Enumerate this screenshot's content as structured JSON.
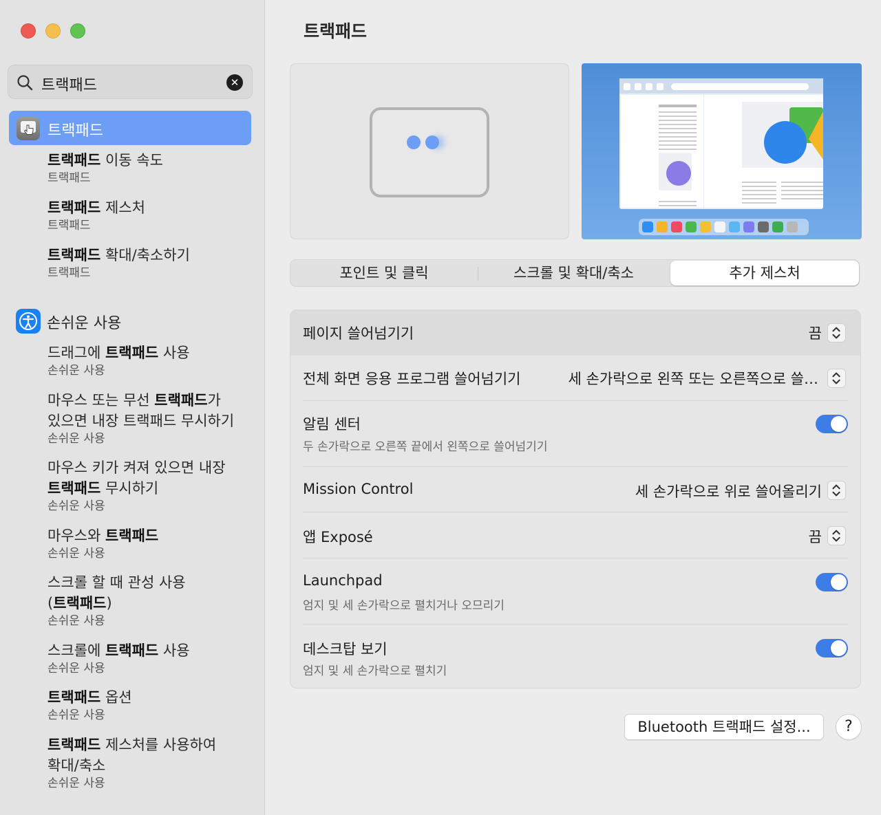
{
  "sidebar": {
    "search": {
      "value": "트랙패드",
      "placeholder": ""
    },
    "selected": {
      "label": "트랙패드"
    },
    "results_top": [
      {
        "title": "트랙패드 이동 속도",
        "bold": "트랙패드",
        "rest": " 이동 속도",
        "sub": "트랙패드"
      },
      {
        "title": "트랙패드 제스처",
        "bold": "트랙패드",
        "rest": " 제스처",
        "sub": "트랙패드"
      },
      {
        "title": "트랙패드 확대/축소하기",
        "bold": "트랙패드",
        "rest": " 확대/축소하기",
        "sub": "트랙패드"
      }
    ],
    "section": {
      "label": "손쉬운 사용"
    },
    "results_accessibility": [
      {
        "lines": [
          "드래그에 [트랙패드] 사용"
        ],
        "sub": "손쉬운 사용"
      },
      {
        "lines": [
          "마우스 또는 무선 [트랙패드]가",
          "있으면 내장 트랙패드 무시하기"
        ],
        "sub": "손쉬운 사용"
      },
      {
        "lines": [
          "마우스 키가 켜져 있으면 내장",
          "[트랙패드] 무시하기"
        ],
        "sub": "손쉬운 사용"
      },
      {
        "lines": [
          "마우스와 [트랙패드]"
        ],
        "sub": "손쉬운 사용"
      },
      {
        "lines": [
          "스크롤 할 때 관성 사용",
          "([트랙패드])"
        ],
        "sub": "손쉬운 사용"
      },
      {
        "lines": [
          "스크롤에 [트랙패드] 사용"
        ],
        "sub": "손쉬운 사용"
      },
      {
        "lines": [
          "[트랙패드] 옵션"
        ],
        "sub": "손쉬운 사용"
      },
      {
        "lines": [
          "[트랙패드] 제스처를 사용하여",
          "확대/축소"
        ],
        "sub": "손쉬운 사용"
      }
    ]
  },
  "main": {
    "title": "트랙패드",
    "tabs": [
      {
        "label": "포인트 및 클릭"
      },
      {
        "label": "스크롤 및 확대/축소"
      },
      {
        "label": "추가 제스처"
      }
    ],
    "rows": [
      {
        "label": "페이지 쓸어넘기기",
        "value": "끔",
        "type": "select"
      },
      {
        "label": "전체 화면 응용 프로그램 쓸어넘기기",
        "value": "세 손가락으로 왼쪽 또는 오른쪽으로 쓸…",
        "type": "select"
      },
      {
        "label": "알림 센터",
        "sub": "두 손가락으로 오른쪽 끝에서 왼쪽으로 쓸어넘기기",
        "type": "toggle",
        "on": true
      },
      {
        "label": "Mission Control",
        "value": "세 손가락으로 위로 쓸어올리기",
        "type": "select"
      },
      {
        "label": "앱 Exposé",
        "value": "끔",
        "type": "select"
      },
      {
        "label": "Launchpad",
        "sub": "엄지 및 세 손가락으로 펼치거나 오므리기",
        "type": "toggle",
        "on": true
      },
      {
        "label": "데스크탑 보기",
        "sub": "엄지 및 세 손가락으로 펼치기",
        "type": "toggle",
        "on": true
      }
    ],
    "bluetooth_button": "Bluetooth 트랙패드 설정...",
    "help_button": "?"
  },
  "colors": {
    "accent": "#6b9ef4",
    "toggle_on": "#3f7de6",
    "accessibility_icon": "#1a80f5"
  },
  "icons": {
    "search": "search-icon",
    "clear": "clear-search-icon",
    "trackpad": "trackpad-icon",
    "accessibility": "accessibility-icon",
    "stepper": "chevron-up-down-icon"
  }
}
